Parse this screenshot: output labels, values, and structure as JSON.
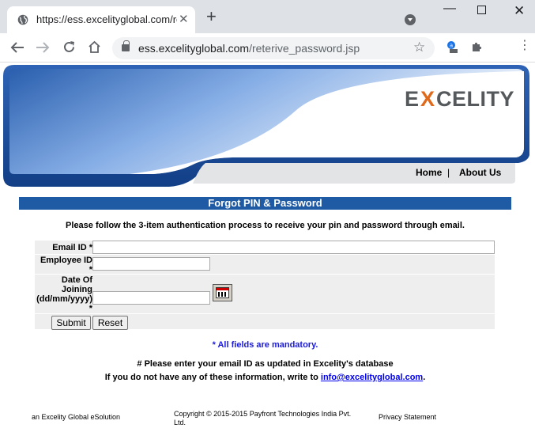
{
  "browser": {
    "tab_title": "https://ess.excelityglobal.com/reterive_password.jsp",
    "tab_close": "✕",
    "new_tab": "+",
    "url_host": "ess.excelityglobal.com",
    "url_path": "/reterive_password.jsp",
    "icons": {
      "favicon": "globe-icon",
      "back": "back-arrow-icon",
      "forward": "forward-arrow-icon",
      "reload": "reload-icon",
      "home": "home-icon",
      "lock": "lock-icon",
      "bookmark": "star-icon",
      "extension1": "lens-extension-icon",
      "extension2": "puzzle-icon",
      "menu": "kebab-menu-icon"
    }
  },
  "header": {
    "logo_text": "EXCELITY",
    "logo_colors": {
      "text": "#55595c",
      "x_accent": "#e06a1b"
    },
    "nav": {
      "home": "Home",
      "separator": "|",
      "about": "About Us"
    }
  },
  "page": {
    "title": "Forgot PIN & Password",
    "title_bar_color": "#1f5aa5",
    "instruction": "Please follow the 3-item authentication process to receive your pin and password through email."
  },
  "form": {
    "email_label": "Email ID *",
    "email_value": "",
    "employee_label_line1": "Employee ID",
    "employee_label_line2": "*",
    "employee_value": "",
    "doj_label_line1": "Date Of",
    "doj_label_line2": "Joining",
    "doj_label_line3": "(dd/mm/yyyy)",
    "doj_label_line4": "*",
    "doj_value": "",
    "calendar_icon": "calendar-icon",
    "submit_label": "Submit",
    "reset_label": "Reset"
  },
  "notes": {
    "mandatory": "* All fields are mandatory.",
    "mandatory_color": "#1a1adf",
    "email_note": "# Please enter your email ID as updated in Excelity's database",
    "contact_prefix": "If you do not have any of these information, write to",
    "contact_email": "info@excelityglobal.com",
    "contact_suffix": "."
  },
  "footer": {
    "tagline": "an Excelity Global eSolution",
    "copyright_line1": "Copyright © 2015-2015 Payfront Technologies India Pvt.",
    "copyright_line2": "Ltd.",
    "privacy": "Privacy Statement"
  }
}
